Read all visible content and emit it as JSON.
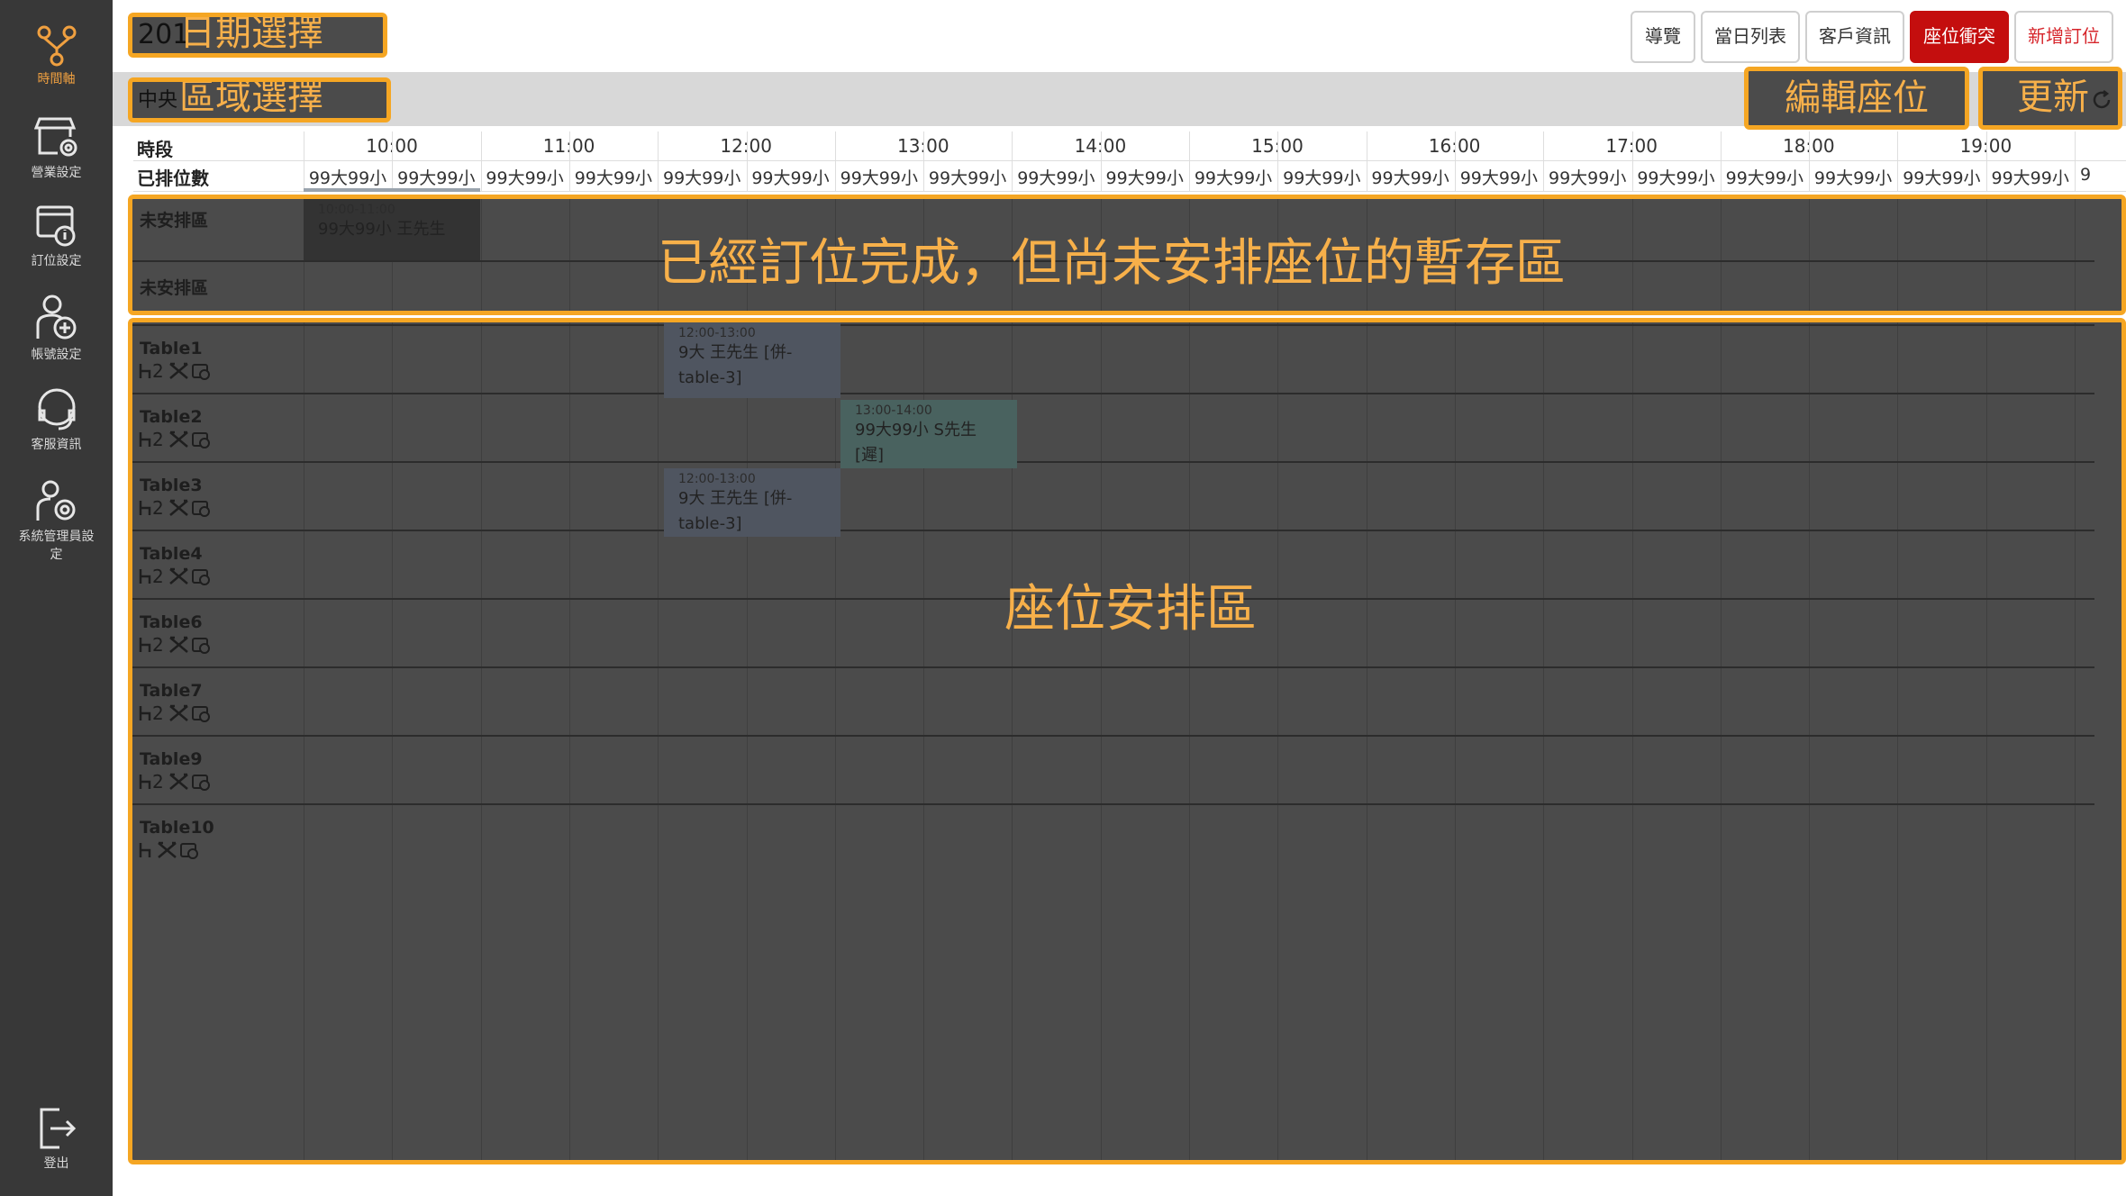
{
  "sidebar": {
    "items": [
      {
        "label": "時間軸",
        "icon": "timeline-icon"
      },
      {
        "label": "營業設定",
        "icon": "store-settings-icon"
      },
      {
        "label": "訂位設定",
        "icon": "booking-settings-icon"
      },
      {
        "label": "帳號設定",
        "icon": "account-settings-icon"
      },
      {
        "label": "客服資訊",
        "icon": "support-icon"
      },
      {
        "label": "系統管理員設定",
        "icon": "admin-settings-icon"
      }
    ],
    "logout_label": "登出"
  },
  "toolbar": {
    "date_value": "201",
    "date_annotation": "日期選擇",
    "area_value": "中央",
    "area_annotation": "區域選擇",
    "buttons": [
      {
        "label": "導覽"
      },
      {
        "label": "當日列表"
      },
      {
        "label": "客戶資訊"
      },
      {
        "label": "座位衝突"
      },
      {
        "label": "新增訂位"
      }
    ],
    "edit_seat_label": "編輯座位",
    "refresh_label": "更新"
  },
  "grid": {
    "period_label": "時段",
    "count_label": "已排位數",
    "hours": [
      "10:00",
      "11:00",
      "12:00",
      "13:00",
      "14:00",
      "15:00",
      "16:00",
      "17:00",
      "18:00",
      "19:00"
    ],
    "count_cell": "99大99小",
    "count_tail": "9"
  },
  "unassigned": {
    "rows": [
      "未安排區",
      "未安排區"
    ],
    "booking": {
      "time": "10:00-11:00",
      "text": "99大99小 王先生"
    },
    "annotation": "已經訂位完成，但尚未安排座位的暫存區"
  },
  "tables": {
    "rows": [
      {
        "name": "Table1",
        "meta": "2"
      },
      {
        "name": "Table2",
        "meta": "2"
      },
      {
        "name": "Table3",
        "meta": "2"
      },
      {
        "name": "Table4",
        "meta": "2"
      },
      {
        "name": "Table6",
        "meta": "2"
      },
      {
        "name": "Table7",
        "meta": "2"
      },
      {
        "name": "Table9",
        "meta": "2"
      },
      {
        "name": "Table10",
        "meta": ""
      }
    ],
    "bookings": [
      {
        "time": "12:00-13:00",
        "line1": "9大 王先生 [併-",
        "line2": "table-3]"
      },
      {
        "time": "13:00-14:00",
        "line1": "99大99小 S先生",
        "line2": "[遲]"
      },
      {
        "time": "12:00-13:00",
        "line1": "9大 王先生 [併-",
        "line2": "table-3]"
      }
    ],
    "annotation": "座位安排區"
  },
  "colors": {
    "sidebar": "#383838",
    "accent": "#f5a623",
    "danger": "#c40e0e",
    "overlay": "#4b4b4b"
  }
}
